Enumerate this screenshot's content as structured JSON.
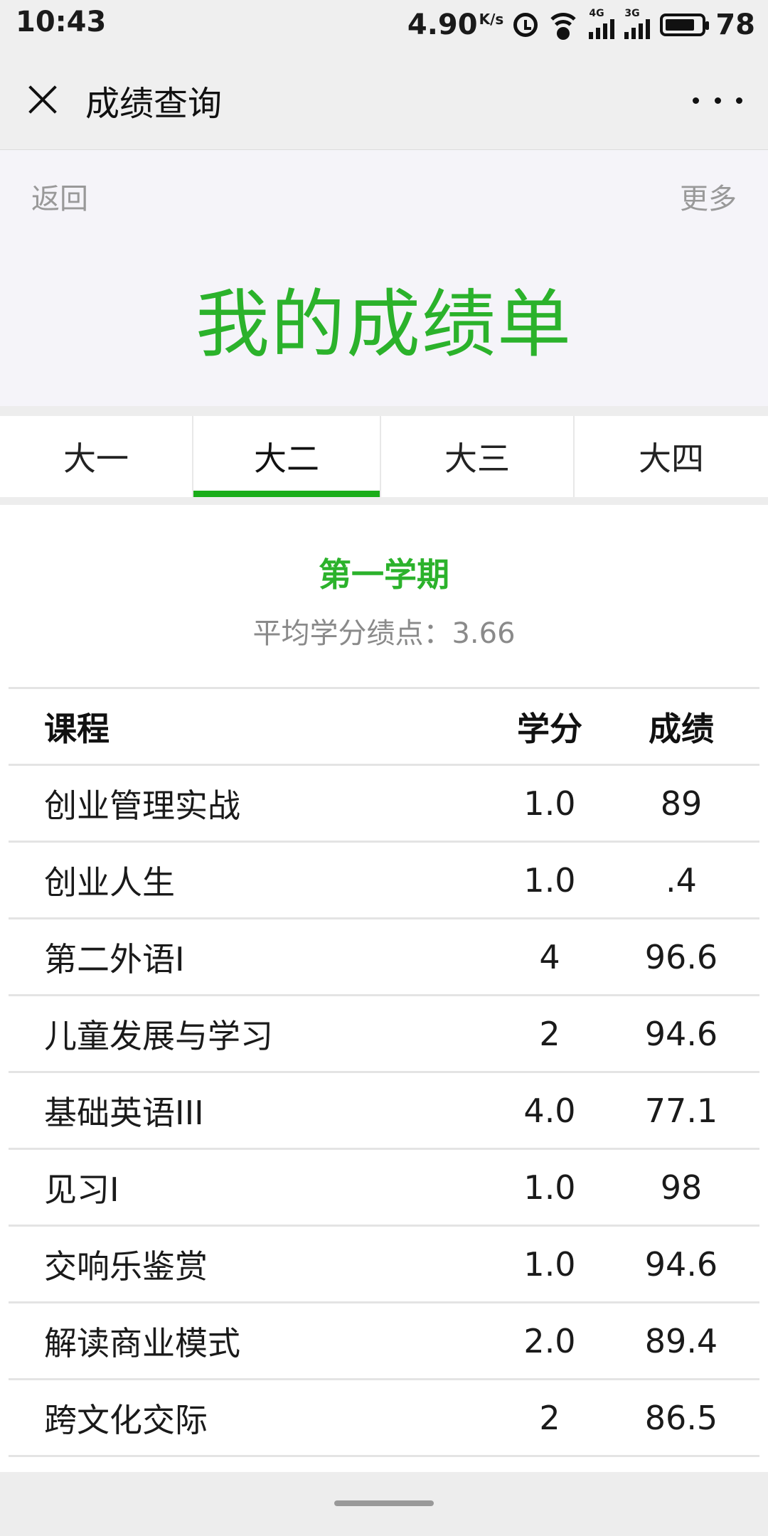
{
  "status_bar": {
    "time": "10:43",
    "net_speed": "4.90",
    "net_speed_unit": "K/s",
    "net1_label": "4G",
    "net2_label": "3G",
    "battery": "78"
  },
  "titlebar": {
    "title": "成绩查询"
  },
  "header": {
    "back_label": "返回",
    "more_label": "更多",
    "page_heading": "我的成绩单"
  },
  "tabs": [
    {
      "label": "大一",
      "active": false
    },
    {
      "label": "大二",
      "active": true
    },
    {
      "label": "大三",
      "active": false
    },
    {
      "label": "大四",
      "active": false
    }
  ],
  "semester": {
    "title": "第一学期",
    "gpa_label": "平均学分绩点：",
    "gpa_value": "3.66"
  },
  "table": {
    "headers": {
      "course": "课程",
      "credit": "学分",
      "score": "成绩"
    },
    "rows": [
      {
        "course": "创业管理实战",
        "credit": "1.0",
        "score": "89"
      },
      {
        "course": "创业人生",
        "credit": "1.0",
        "score": ".4"
      },
      {
        "course": "第二外语I",
        "credit": "4",
        "score": "96.6"
      },
      {
        "course": "儿童发展与学习",
        "credit": "2",
        "score": "94.6"
      },
      {
        "course": "基础英语III",
        "credit": "4.0",
        "score": "77.1"
      },
      {
        "course": "见习I",
        "credit": "1.0",
        "score": "98"
      },
      {
        "course": "交响乐鉴赏",
        "credit": "1.0",
        "score": "94.6"
      },
      {
        "course": "解读商业模式",
        "credit": "2.0",
        "score": "89.4"
      },
      {
        "course": "跨文化交际",
        "credit": "2",
        "score": "86.5"
      }
    ]
  },
  "colors": {
    "accent": "#2bb22b",
    "tab_indicator": "#1aad19"
  }
}
